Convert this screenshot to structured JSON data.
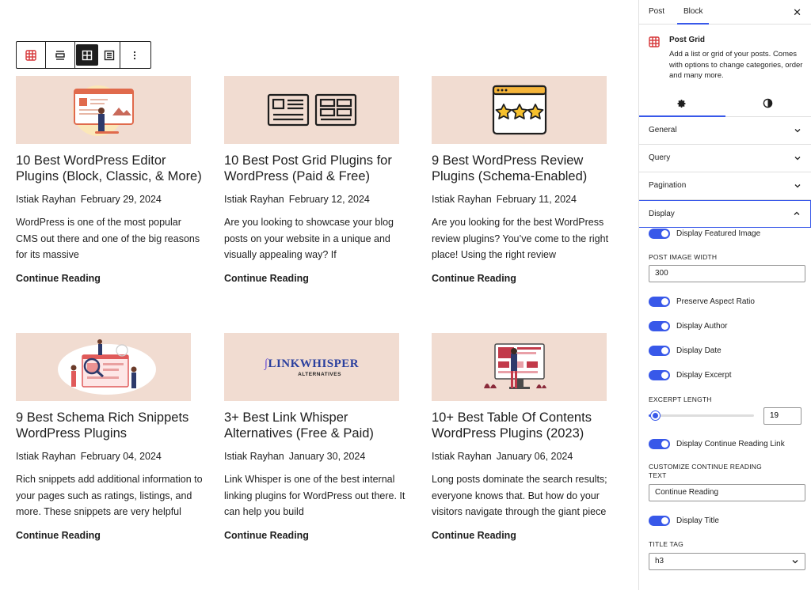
{
  "sidebar": {
    "tabs": [
      {
        "label": "Post",
        "active": false
      },
      {
        "label": "Block",
        "active": true
      }
    ],
    "close_glyph": "✕",
    "block": {
      "name": "Post Grid",
      "description": "Add a list or grid of your posts. Comes with options to change categories, order and many more.",
      "icon": "grid-icon"
    },
    "style_tabs": [
      {
        "icon": "gear-icon",
        "active": true
      },
      {
        "icon": "contrast-icon",
        "active": false
      }
    ],
    "panels": {
      "general": "General",
      "query": "Query",
      "pagination": "Pagination",
      "display": "Display"
    },
    "display": {
      "featured_image": "Display Featured Image",
      "image_width_label": "POST IMAGE WIDTH",
      "image_width_value": "300",
      "preserve_ratio": "Preserve Aspect Ratio",
      "author": "Display Author",
      "date": "Display Date",
      "excerpt": "Display Excerpt",
      "excerpt_length_label": "EXCERPT LENGTH",
      "excerpt_length_value": "19",
      "excerpt_length_fraction": 0.06,
      "continue_link": "Display Continue Reading Link",
      "continue_text_label": "CUSTOMIZE CONTINUE READING TEXT",
      "continue_text_value": "Continue Reading",
      "title": "Display Title",
      "title_tag_label": "TITLE TAG",
      "title_tag_value": "h3"
    },
    "accent_color": "#3858e9"
  },
  "posts": [
    {
      "title": "10 Best WordPress Editor Plugins (Block, Classic, & More)",
      "author": "Istiak Rayhan",
      "date": "February 29, 2024",
      "excerpt": "WordPress is one of the most popular CMS out there and one of the big reasons for its massive",
      "more": "Continue Reading"
    },
    {
      "title": "10 Best Post Grid Plugins for WordPress (Paid & Free)",
      "author": "Istiak Rayhan",
      "date": "February 12, 2024",
      "excerpt": "Are you looking to showcase your blog posts on your website in a unique and visually appealing way? If",
      "more": "Continue Reading"
    },
    {
      "title": "9 Best WordPress Review Plugins (Schema-Enabled)",
      "author": "Istiak Rayhan",
      "date": "February 11, 2024",
      "excerpt": "Are you looking for the best WordPress review plugins? You’ve come to the right place! Using the right review",
      "more": "Continue Reading"
    },
    {
      "title": "9 Best Schema Rich Snippets WordPress Plugins",
      "author": "Istiak Rayhan",
      "date": "February 04, 2024",
      "excerpt": "Rich snippets add additional information to your pages such as ratings, listings, and more. These snippets are very helpful",
      "more": "Continue Reading"
    },
    {
      "title": "3+ Best Link Whisper Alternatives (Free & Paid)",
      "author": "Istiak Rayhan",
      "date": "January 30, 2024",
      "excerpt": "Link Whisper is one of the best internal linking plugins for WordPress out there. It can help you build",
      "more": "Continue Reading",
      "thumb_logo": "LINKWHISPER",
      "thumb_sub": "ALTERNATIVES"
    },
    {
      "title": "10+ Best Table Of Contents WordPress Plugins (2023)",
      "author": "Istiak Rayhan",
      "date": "January 06, 2024",
      "excerpt": "Long posts dominate the search results; everyone knows that. But how do your visitors navigate through the giant piece",
      "more": "Continue Reading"
    }
  ],
  "colors": {
    "thumb_bg": "#f1dcd1",
    "text": "#1e1e1e"
  }
}
